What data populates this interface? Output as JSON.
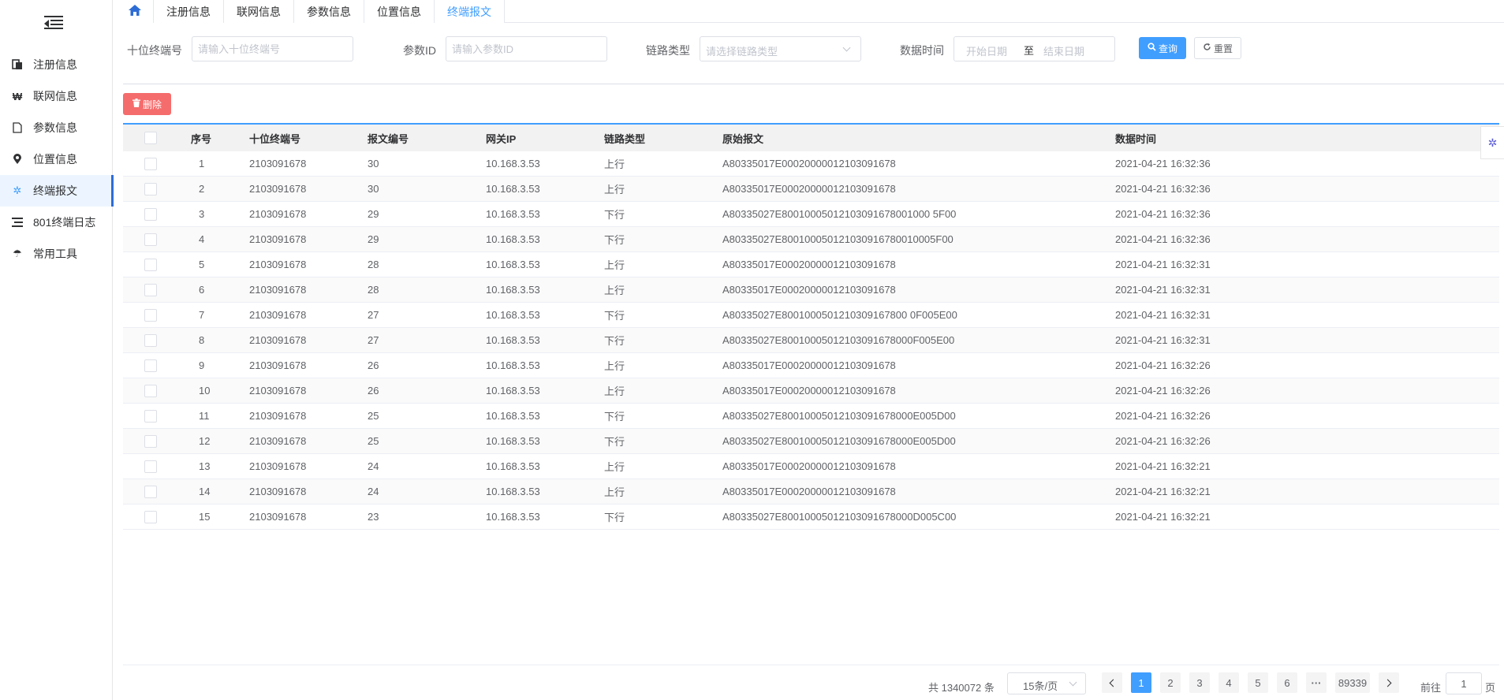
{
  "tabs": [
    {
      "label": "注册信息"
    },
    {
      "label": "联网信息"
    },
    {
      "label": "参数信息"
    },
    {
      "label": "位置信息"
    },
    {
      "label": "终端报文"
    }
  ],
  "sidebar": {
    "items": [
      {
        "label": "注册信息",
        "icon": "register-icon"
      },
      {
        "label": "联网信息",
        "icon": "network-icon"
      },
      {
        "label": "参数信息",
        "icon": "document-icon"
      },
      {
        "label": "位置信息",
        "icon": "location-icon"
      },
      {
        "label": "终端报文",
        "icon": "gear-icon"
      },
      {
        "label": "801终端日志",
        "icon": "log-icon"
      },
      {
        "label": "常用工具",
        "icon": "tool-icon"
      }
    ]
  },
  "filters": {
    "terminal_label": "十位终端号",
    "terminal_placeholder": "请输入十位终端号",
    "param_label": "参数ID",
    "param_placeholder": "请输入参数ID",
    "link_label": "链路类型",
    "link_placeholder": "请选择链路类型",
    "time_label": "数据时间",
    "start_placeholder": "开始日期",
    "range_sep": "至",
    "end_placeholder": "结束日期",
    "query_label": "查询",
    "reset_label": "重置"
  },
  "toolbar": {
    "delete_label": "删除"
  },
  "table": {
    "headers": [
      "序号",
      "十位终端号",
      "报文编号",
      "网关IP",
      "链路类型",
      "原始报文",
      "数据时间"
    ],
    "rows": [
      [
        "1",
        "2103091678",
        "30",
        "10.168.3.53",
        "上行",
        "A80335017E00020000012103091678",
        "2021-04-21 16:32:36"
      ],
      [
        "2",
        "2103091678",
        "30",
        "10.168.3.53",
        "上行",
        "A80335017E00020000012103091678",
        "2021-04-21 16:32:36"
      ],
      [
        "3",
        "2103091678",
        "29",
        "10.168.3.53",
        "下行",
        "A80335027E80010005012103091678001000 5F00",
        "2021-04-21 16:32:36"
      ],
      [
        "4",
        "2103091678",
        "29",
        "10.168.3.53",
        "下行",
        "A80335027E800100050121030916780010005F00",
        "2021-04-21 16:32:36"
      ],
      [
        "5",
        "2103091678",
        "28",
        "10.168.3.53",
        "上行",
        "A80335017E00020000012103091678",
        "2021-04-21 16:32:31"
      ],
      [
        "6",
        "2103091678",
        "28",
        "10.168.3.53",
        "上行",
        "A80335017E00020000012103091678",
        "2021-04-21 16:32:31"
      ],
      [
        "7",
        "2103091678",
        "27",
        "10.168.3.53",
        "下行",
        "A80335027E8001000501210309167800 0F005E00",
        "2021-04-21 16:32:31"
      ],
      [
        "8",
        "2103091678",
        "27",
        "10.168.3.53",
        "下行",
        "A80335027E80010005012103091678000F005E00",
        "2021-04-21 16:32:31"
      ],
      [
        "9",
        "2103091678",
        "26",
        "10.168.3.53",
        "上行",
        "A80335017E00020000012103091678",
        "2021-04-21 16:32:26"
      ],
      [
        "10",
        "2103091678",
        "26",
        "10.168.3.53",
        "上行",
        "A80335017E00020000012103091678",
        "2021-04-21 16:32:26"
      ],
      [
        "11",
        "2103091678",
        "25",
        "10.168.3.53",
        "下行",
        "A80335027E80010005012103091678000E005D00",
        "2021-04-21 16:32:26"
      ],
      [
        "12",
        "2103091678",
        "25",
        "10.168.3.53",
        "下行",
        "A80335027E80010005012103091678000E005D00",
        "2021-04-21 16:32:26"
      ],
      [
        "13",
        "2103091678",
        "24",
        "10.168.3.53",
        "上行",
        "A80335017E00020000012103091678",
        "2021-04-21 16:32:21"
      ],
      [
        "14",
        "2103091678",
        "24",
        "10.168.3.53",
        "上行",
        "A80335017E00020000012103091678",
        "2021-04-21 16:32:21"
      ],
      [
        "15",
        "2103091678",
        "23",
        "10.168.3.53",
        "下行",
        "A80335027E80010005012103091678000D005C00",
        "2021-04-21 16:32:21"
      ]
    ]
  },
  "pagination": {
    "total_text": "共 1340072 条",
    "page_size": "15条/页",
    "pages": [
      "1",
      "2",
      "3",
      "4",
      "5",
      "6"
    ],
    "ellipsis": "···",
    "last_page": "89339",
    "goto_prefix": "前往",
    "goto_value": "1",
    "goto_suffix": "页"
  },
  "colors": {
    "primary": "#409eff",
    "danger": "#f56c6c",
    "active_bar": "#2d6cd6"
  }
}
